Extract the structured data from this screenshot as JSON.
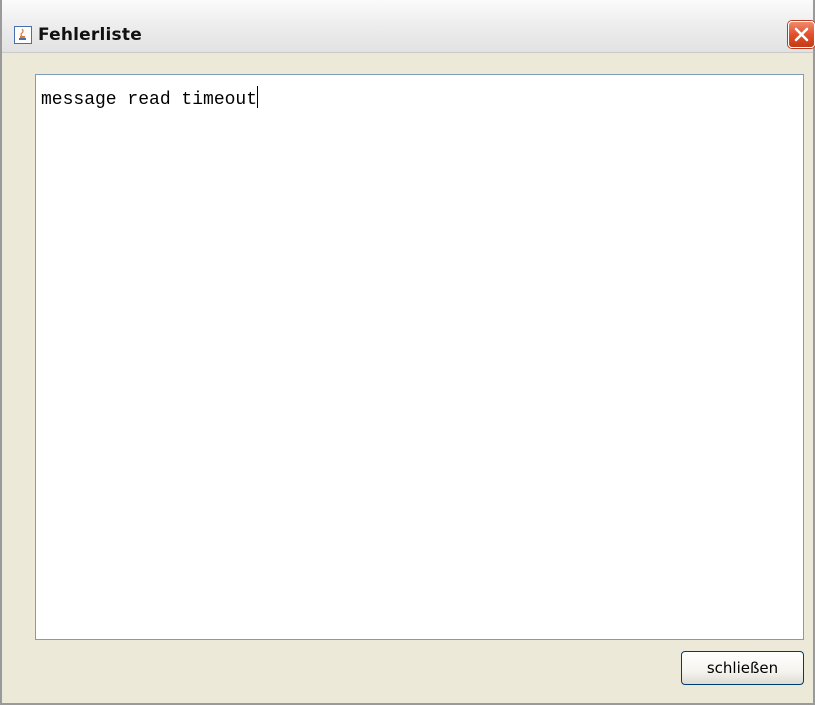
{
  "window": {
    "title": "Fehlerliste",
    "app_icon": "java-coffee-icon",
    "close_icon": "close-icon"
  },
  "textarea": {
    "content": "message read timeout"
  },
  "footer": {
    "close_label": "schließen"
  },
  "colors": {
    "dialog_background": "#ece9d8",
    "textarea_border": "#7f9db9",
    "close_button_red": "#e2502c"
  }
}
